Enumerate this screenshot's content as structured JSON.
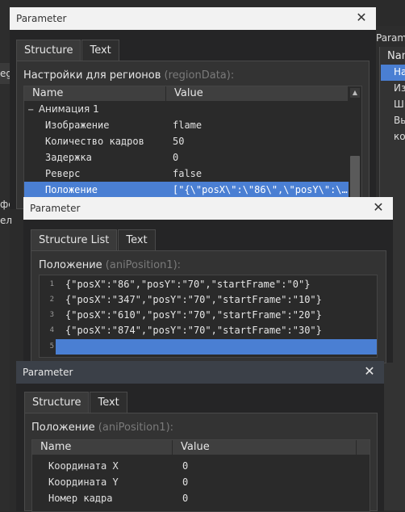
{
  "background_window": {
    "title_partial": "Param",
    "header_partial": "Nam",
    "items": [
      "На",
      "Из",
      "Ши",
      "Вы",
      "ко"
    ],
    "left_partial": [
      "eg",
      "фе",
      "ел"
    ]
  },
  "window1": {
    "title": "Parameter",
    "tabs": [
      "Structure",
      "Text"
    ],
    "section_label": "Настройки для регионов",
    "section_hint": "(regionData):",
    "columns": [
      "Name",
      "Value"
    ],
    "group": {
      "toggle": "−",
      "name": "Анимация 1"
    },
    "rows": [
      {
        "name": "Изображение",
        "value": "flame"
      },
      {
        "name": "Количество кадров",
        "value": "50"
      },
      {
        "name": "Задержка",
        "value": "0"
      },
      {
        "name": "Реверс",
        "value": "false"
      },
      {
        "name": "Положение",
        "value": "[\"{\\\"posX\\\":\\\"86\\\",\\\"posY\\\":\\…"
      }
    ]
  },
  "window2": {
    "title": "Parameter",
    "tabs": [
      "Structure List",
      "Text"
    ],
    "section_label": "Положение",
    "section_hint": "(aniPosition1):",
    "lines": [
      {
        "num": "1",
        "text": "{\"posX\":\"86\",\"posY\":\"70\",\"startFrame\":\"0\"}"
      },
      {
        "num": "2",
        "text": "{\"posX\":\"347\",\"posY\":\"70\",\"startFrame\":\"10\"}"
      },
      {
        "num": "3",
        "text": "{\"posX\":\"610\",\"posY\":\"70\",\"startFrame\":\"20\"}"
      },
      {
        "num": "4",
        "text": "{\"posX\":\"874\",\"posY\":\"70\",\"startFrame\":\"30\"}"
      },
      {
        "num": "5",
        "text": ""
      }
    ]
  },
  "window3": {
    "title": "Parameter",
    "tabs": [
      "Structure",
      "Text"
    ],
    "section_label": "Положение",
    "section_hint": "(aniPosition1):",
    "columns": [
      "Name",
      "Value"
    ],
    "rows": [
      {
        "name": "Координата X",
        "value": "0"
      },
      {
        "name": "Координата Y",
        "value": "0"
      },
      {
        "name": "Номер кадра",
        "value": "0"
      }
    ]
  },
  "colors": {
    "selection": "#4a7fd3",
    "hint": "#7a7a7a"
  }
}
